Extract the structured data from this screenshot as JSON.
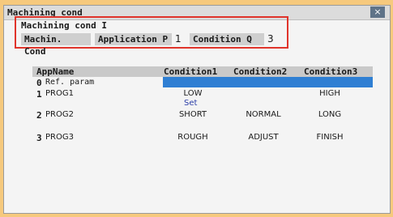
{
  "window": {
    "title": "Machining cond",
    "close_symbol": "×"
  },
  "header": {
    "mode_title": "Machining cond I",
    "label_machin": "Machin. Cond",
    "label_app": "Application P",
    "app_value": "1",
    "label_cond": "Condition Q",
    "cond_value": "3"
  },
  "table": {
    "columns": [
      "AppName",
      "Condition1",
      "Condition2",
      "Condition3"
    ],
    "rows": [
      {
        "num": "0",
        "name": "Ref. param",
        "c1": "",
        "c2": "",
        "c3": ""
      },
      {
        "num": "1",
        "name": "PROG1",
        "c1": "LOW",
        "c1_sub": "Set",
        "c2": "",
        "c3": "HIGH"
      },
      {
        "num": "2",
        "name": "PROG2",
        "c1": "SHORT",
        "c2": "NORMAL",
        "c3": "LONG"
      },
      {
        "num": "3",
        "name": "PROG3",
        "c1": "ROUGH",
        "c2": "ADJUST",
        "c3": "FINISH"
      }
    ]
  },
  "colors": {
    "accent_red": "#e0342b",
    "selection_blue": "#2f7fd3",
    "frame_orange": "#f6c97d"
  }
}
